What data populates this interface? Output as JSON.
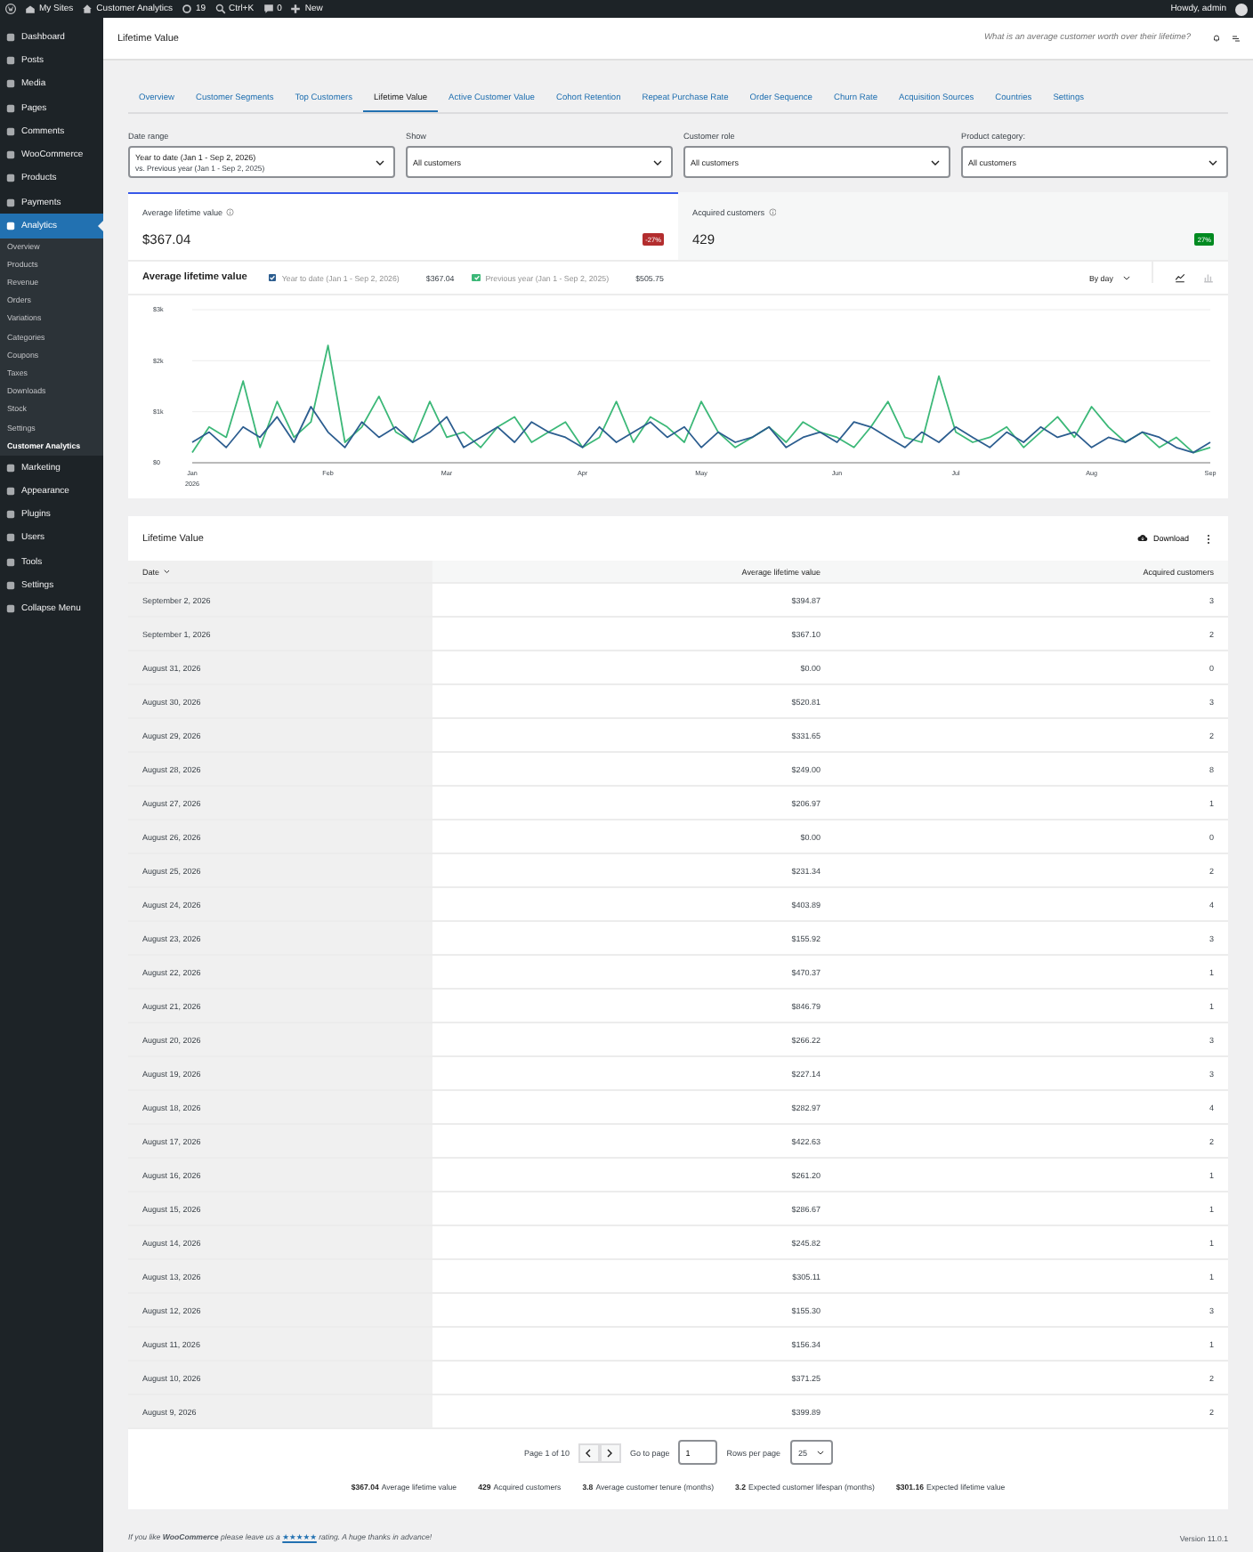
{
  "admin_bar": {
    "items": [
      "My Sites",
      "Customer Analytics",
      "19",
      "Ctrl+K",
      "0",
      "New"
    ],
    "greeting": "Howdy, admin"
  },
  "sidebar": {
    "items": [
      {
        "label": "Dashboard",
        "kind": "main",
        "selected": false
      },
      {
        "label": "Posts",
        "kind": "main",
        "selected": false
      },
      {
        "label": "Media",
        "kind": "main",
        "selected": false
      },
      {
        "label": "Pages",
        "kind": "main",
        "selected": false
      },
      {
        "label": "Comments",
        "kind": "main",
        "selected": false
      },
      {
        "label": "WooCommerce",
        "kind": "main",
        "selected": false
      },
      {
        "label": "Products",
        "kind": "main",
        "selected": false
      },
      {
        "label": "Payments",
        "kind": "main",
        "selected": false
      },
      {
        "label": "Analytics",
        "kind": "main",
        "selected": true
      },
      {
        "label": "Overview",
        "kind": "sub",
        "selected": false
      },
      {
        "label": "Products",
        "kind": "sub",
        "selected": false
      },
      {
        "label": "Revenue",
        "kind": "sub",
        "selected": false
      },
      {
        "label": "Orders",
        "kind": "sub",
        "selected": false
      },
      {
        "label": "Variations",
        "kind": "sub",
        "selected": false
      },
      {
        "label": "Categories",
        "kind": "sub",
        "selected": false
      },
      {
        "label": "Coupons",
        "kind": "sub",
        "selected": false
      },
      {
        "label": "Taxes",
        "kind": "sub",
        "selected": false
      },
      {
        "label": "Downloads",
        "kind": "sub",
        "selected": false
      },
      {
        "label": "Stock",
        "kind": "sub",
        "selected": false
      },
      {
        "label": "Settings",
        "kind": "sub",
        "selected": false
      },
      {
        "label": "Customer Analytics",
        "kind": "sub",
        "selected": true
      },
      {
        "label": "Marketing",
        "kind": "main",
        "selected": false
      },
      {
        "label": "Appearance",
        "kind": "main",
        "selected": false
      },
      {
        "label": "Plugins",
        "kind": "main",
        "selected": false
      },
      {
        "label": "Users",
        "kind": "main",
        "selected": false
      },
      {
        "label": "Tools",
        "kind": "main",
        "selected": false
      },
      {
        "label": "Settings",
        "kind": "main",
        "selected": false
      },
      {
        "label": "Collapse Menu",
        "kind": "main",
        "selected": false
      }
    ]
  },
  "header": {
    "title": "Lifetime Value",
    "question": "What is an average customer worth over their lifetime?"
  },
  "tabs": [
    {
      "label": "Overview",
      "selected": false
    },
    {
      "label": "Customer Segments",
      "selected": false
    },
    {
      "label": "Top Customers",
      "selected": false
    },
    {
      "label": "Lifetime Value",
      "selected": true
    },
    {
      "label": "Active Customer Value",
      "selected": false
    },
    {
      "label": "Cohort Retention",
      "selected": false
    },
    {
      "label": "Repeat Purchase Rate",
      "selected": false
    },
    {
      "label": "Order Sequence",
      "selected": false
    },
    {
      "label": "Churn Rate",
      "selected": false
    },
    {
      "label": "Acquisition Sources",
      "selected": false
    },
    {
      "label": "Countries",
      "selected": false
    },
    {
      "label": "Settings",
      "selected": false
    }
  ],
  "filters": [
    {
      "label": "Date range",
      "value": "Year to date (Jan 1 - Sep 2, 2026)",
      "secondary": "vs. Previous year (Jan 1 - Sep 2, 2025)"
    },
    {
      "label": "Show",
      "value": "All customers"
    },
    {
      "label": "Customer role",
      "value": "All customers"
    },
    {
      "label": "Product category:",
      "value": "All customers"
    }
  ],
  "metrics": [
    {
      "label": "Average lifetime value",
      "value": "$367.04",
      "delta": "-27%",
      "color": "#b32d2e",
      "selected": true
    },
    {
      "label": "Acquired customers",
      "value": "429",
      "delta": "27%",
      "color": "#008a20",
      "selected": false
    }
  ],
  "chart": {
    "title": "Average lifetime value",
    "legend": [
      {
        "checked": true,
        "total": "$367.04"
      },
      {
        "checked": true,
        "total": "$505.75"
      }
    ],
    "interval": "By day",
    "chart_data": {
      "type": "line",
      "ylim": [
        0,
        3000
      ],
      "categories": [
        "Jan 2026",
        null,
        null,
        null,
        null,
        null,
        null,
        null,
        "Feb",
        null,
        null,
        null,
        null,
        null,
        null,
        "Mar",
        null,
        null,
        null,
        null,
        null,
        null,
        null,
        "Apr",
        null,
        null,
        null,
        null,
        null,
        null,
        "May",
        null,
        null,
        null,
        null,
        null,
        null,
        null,
        "Jun",
        null,
        null,
        null,
        null,
        null,
        null,
        "Jul",
        null,
        null,
        null,
        null,
        null,
        null,
        null,
        "Aug",
        null,
        null,
        null,
        null,
        null,
        null,
        "Sep"
      ],
      "yticks": [
        {
          "value": 0,
          "label": "$0"
        },
        {
          "value": 1000,
          "label": "$1k"
        },
        {
          "value": 2000,
          "label": "$2k"
        },
        {
          "value": 3000,
          "label": "$3k"
        }
      ],
      "series": [
        {
          "name": "Year to date (Jan 1 - Sep 2, 2026)",
          "color": "#2c5d8f",
          "values": [
            400,
            600,
            300,
            700,
            500,
            900,
            400,
            1100,
            600,
            300,
            800,
            500,
            700,
            400,
            600,
            900,
            300,
            500,
            700,
            400,
            800,
            600,
            500,
            300,
            700,
            400,
            600,
            800,
            500,
            700,
            300,
            600,
            400,
            500,
            700,
            300,
            500,
            600,
            400,
            800,
            700,
            500,
            300,
            600,
            400,
            700,
            500,
            300,
            600,
            400,
            700,
            500,
            600,
            300,
            500,
            400,
            600,
            500,
            300,
            200,
            400
          ]
        },
        {
          "name": "Previous year (Jan 1 - Sep 2, 2025)",
          "color": "#3cb878",
          "values": [
            200,
            700,
            500,
            1600,
            300,
            1200,
            500,
            800,
            2300,
            400,
            700,
            1300,
            600,
            400,
            1200,
            500,
            600,
            300,
            700,
            900,
            400,
            600,
            800,
            300,
            500,
            1200,
            400,
            900,
            700,
            400,
            1200,
            600,
            300,
            500,
            700,
            400,
            800,
            600,
            500,
            300,
            700,
            1200,
            500,
            400,
            1700,
            600,
            400,
            500,
            700,
            300,
            600,
            900,
            500,
            1100,
            700,
            400,
            600,
            300,
            500,
            200,
            300
          ]
        }
      ]
    }
  },
  "table": {
    "title": "Lifetime Value",
    "download": "Download",
    "columns": [
      {
        "label": "Date",
        "sorted": true
      },
      {
        "label": "Average lifetime value",
        "sorted": false
      },
      {
        "label": "Acquired customers",
        "sorted": false
      }
    ],
    "rows": [
      [
        "September 2, 2026",
        "$394.87",
        "3"
      ],
      [
        "September 1, 2026",
        "$367.10",
        "2"
      ],
      [
        "August 31, 2026",
        "$0.00",
        "0"
      ],
      [
        "August 30, 2026",
        "$520.81",
        "3"
      ],
      [
        "August 29, 2026",
        "$331.65",
        "2"
      ],
      [
        "August 28, 2026",
        "$249.00",
        "8"
      ],
      [
        "August 27, 2026",
        "$206.97",
        "1"
      ],
      [
        "August 26, 2026",
        "$0.00",
        "0"
      ],
      [
        "August 25, 2026",
        "$231.34",
        "2"
      ],
      [
        "August 24, 2026",
        "$403.89",
        "4"
      ],
      [
        "August 23, 2026",
        "$155.92",
        "3"
      ],
      [
        "August 22, 2026",
        "$470.37",
        "1"
      ],
      [
        "August 21, 2026",
        "$846.79",
        "1"
      ],
      [
        "August 20, 2026",
        "$266.22",
        "3"
      ],
      [
        "August 19, 2026",
        "$227.14",
        "3"
      ],
      [
        "August 18, 2026",
        "$282.97",
        "4"
      ],
      [
        "August 17, 2026",
        "$422.63",
        "2"
      ],
      [
        "August 16, 2026",
        "$261.20",
        "1"
      ],
      [
        "August 15, 2026",
        "$286.67",
        "1"
      ],
      [
        "August 14, 2026",
        "$245.82",
        "1"
      ],
      [
        "August 13, 2026",
        "$305.11",
        "1"
      ],
      [
        "August 12, 2026",
        "$155.30",
        "3"
      ],
      [
        "August 11, 2026",
        "$156.34",
        "1"
      ],
      [
        "August 10, 2026",
        "$371.25",
        "2"
      ],
      [
        "August 9, 2026",
        "$399.89",
        "2"
      ]
    ],
    "pagination": {
      "page_label": "Page 1 of 10",
      "go_to": "Go to page",
      "page": "1",
      "rows_label": "Rows per page",
      "rows": "25"
    },
    "summary": [
      {
        "value": "$367.04",
        "label": "Average lifetime value"
      },
      {
        "value": "429",
        "label": "Acquired customers"
      },
      {
        "value": "3.8",
        "label": "Average customer tenure (months)"
      },
      {
        "value": "3.2",
        "label": "Expected customer lifespan (months)"
      },
      {
        "value": "$301.16",
        "label": "Expected lifetime value"
      }
    ]
  },
  "footer": {
    "before": "If you like **WooCommerce** please leave us a",
    "link": "★★★★★",
    "after": "rating. A huge thanks in advance!",
    "version": "Version 11.0.1"
  }
}
